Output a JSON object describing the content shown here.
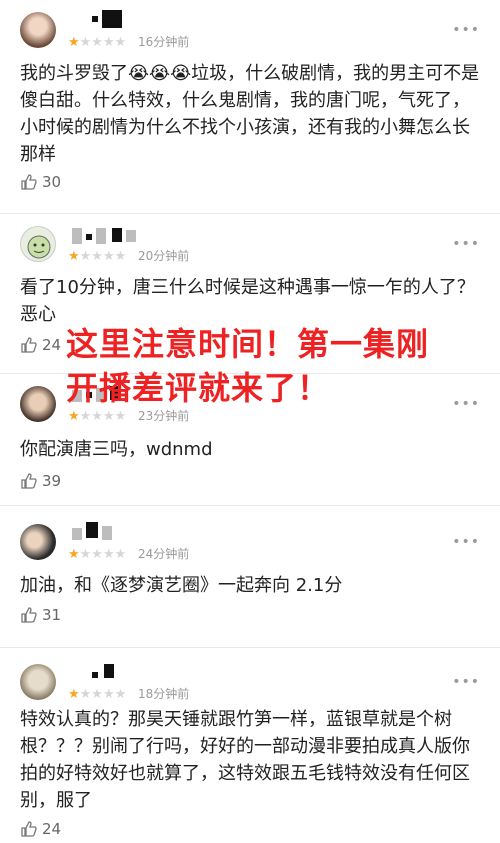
{
  "comments": [
    {
      "rating_stars": "★",
      "rating_empty": "★★★★",
      "time": "16分钟前",
      "text": "我的斗罗毁了😭😭😭垃圾，什么破剧情，我的男主可不是傻白甜。什么特效，什么鬼剧情，我的唐门呢，气死了，小时候的剧情为什么不找个小孩演，还有我的小舞怎么长那样",
      "likes": "30"
    },
    {
      "rating_stars": "★",
      "rating_empty": "★★★★",
      "time": "20分钟前",
      "text": "看了10分钟，唐三什么时候是这种遇事一惊一乍的人了？恶心",
      "likes": "24"
    },
    {
      "rating_stars": "★",
      "rating_empty": "★★★★",
      "time": "23分钟前",
      "text": "你配演唐三吗，wdnmd",
      "likes": "39"
    },
    {
      "rating_stars": "★",
      "rating_empty": "★★★★",
      "time": "24分钟前",
      "text": "加油，和《逐梦演艺圈》一起奔向 2.1分",
      "likes": "31"
    },
    {
      "rating_stars": "★",
      "rating_empty": "★★★★",
      "time": "18分钟前",
      "text": "特效认真的？那昊天锤就跟竹笋一样，蓝银草就是个树根？？？别闹了行吗，好好的一部动漫非要拍成真人版你拍的好特效好也就算了，这特效跟五毛钱特效没有任何区别，服了",
      "likes": "24"
    }
  ],
  "overlay": {
    "line1": "这里注意时间！第一集刚",
    "line2": "开播差评就来了！"
  },
  "icons": {
    "more": "more-dots-icon",
    "like": "thumbs-up-icon",
    "star": "star-icon"
  },
  "colors": {
    "star_on": "#f5a623",
    "star_off": "#d6d6d6",
    "overlay": "#ee2222"
  }
}
